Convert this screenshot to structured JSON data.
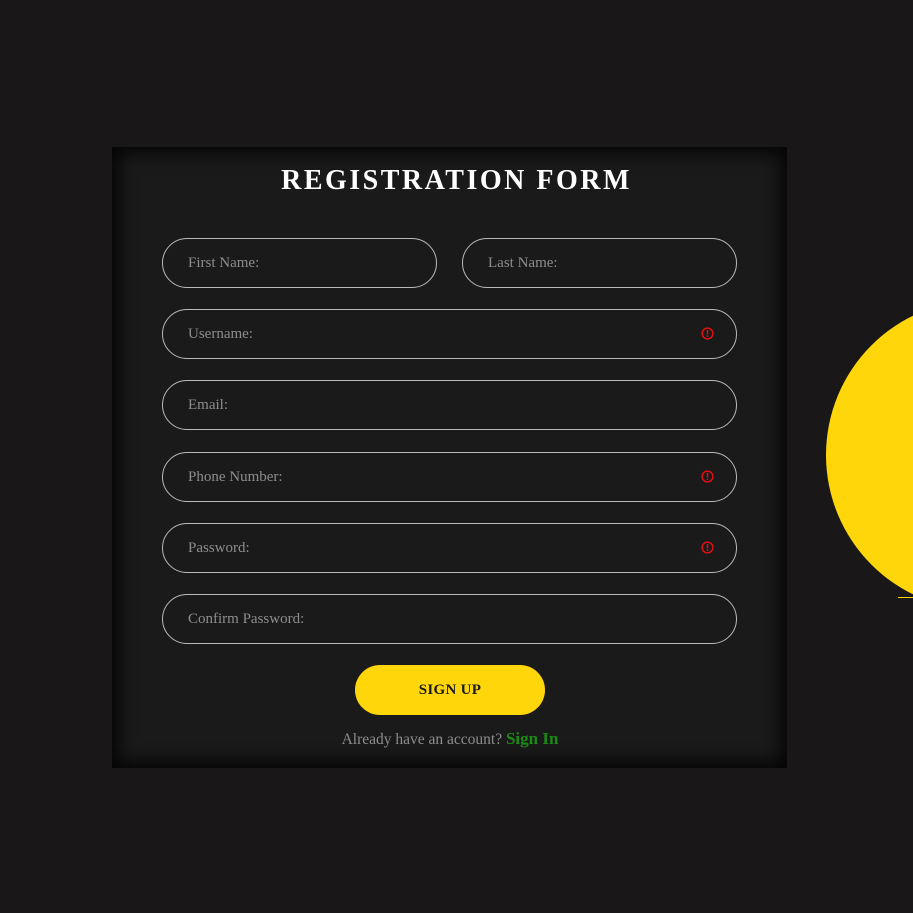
{
  "form": {
    "title": "REGISTRATION FORM",
    "fields": [
      {
        "name": "first-name",
        "placeholder": "First Name:",
        "error_icon": false
      },
      {
        "name": "last-name",
        "placeholder": "Last Name:",
        "error_icon": false
      },
      {
        "name": "username",
        "placeholder": "Username:",
        "error_icon": true
      },
      {
        "name": "email",
        "placeholder": "Email:",
        "error_icon": false
      },
      {
        "name": "phone-number",
        "placeholder": "Phone Number:",
        "error_icon": true
      },
      {
        "name": "password",
        "placeholder": "Password:",
        "error_icon": true
      },
      {
        "name": "confirm-password",
        "placeholder": "Confirm Password:",
        "error_icon": false
      }
    ],
    "submit_label": "SIGN UP",
    "footer_text": "Already have an account?",
    "signin_link": "Sign In"
  },
  "icons": {
    "error": "error-info-icon"
  },
  "colors": {
    "background": "#191718",
    "accent": "#ffd60a",
    "link": "#1a8a14",
    "error": "#e01010",
    "field_border": "#b9b9b9",
    "placeholder": "#8e8c8d"
  }
}
